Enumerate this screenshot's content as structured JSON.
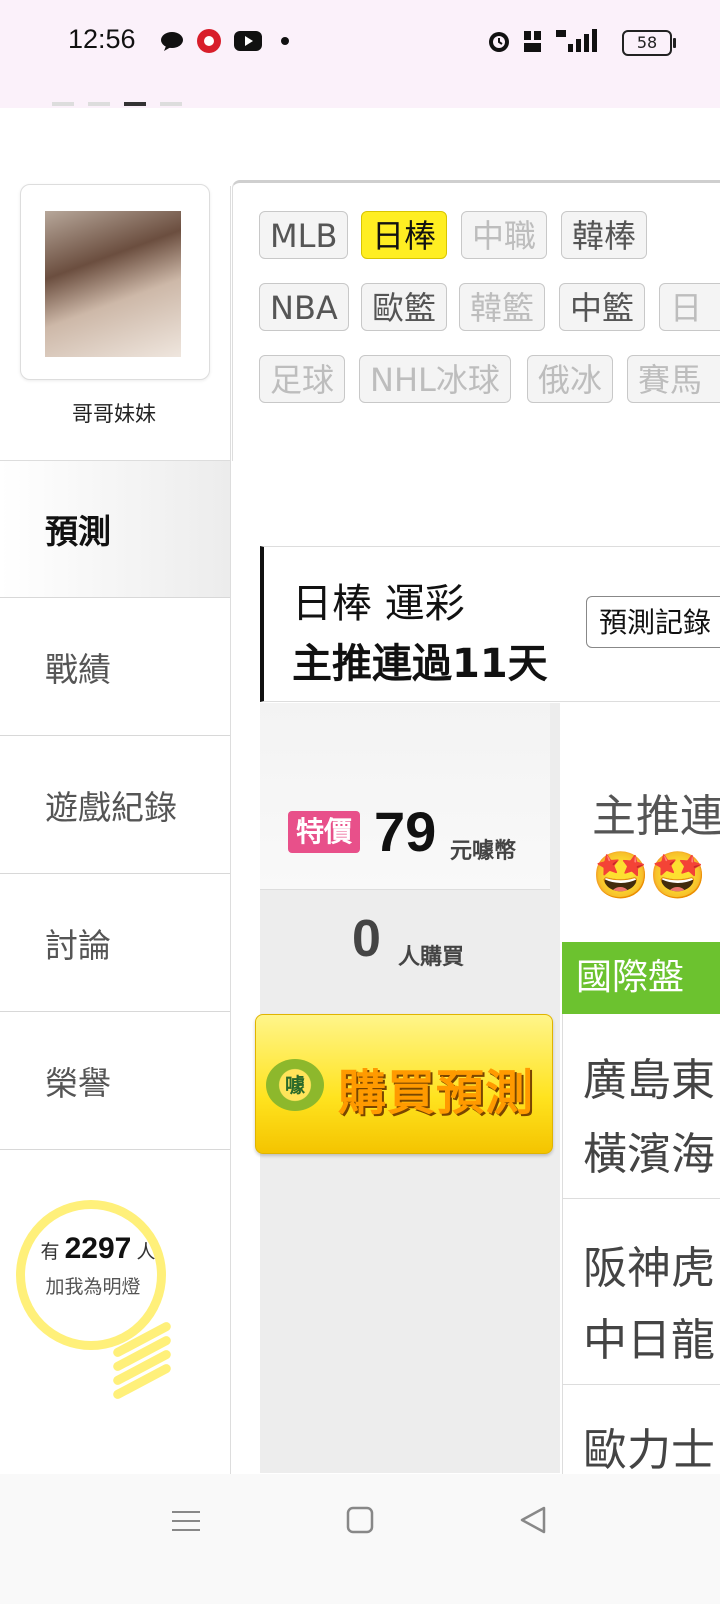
{
  "status_bar": {
    "time": "12:56",
    "battery": "58"
  },
  "profile": {
    "name": "哥哥妹妹"
  },
  "sidebar": {
    "items": [
      {
        "label": "預測"
      },
      {
        "label": "戰績"
      },
      {
        "label": "遊戲紀錄"
      },
      {
        "label": "討論"
      },
      {
        "label": "榮譽"
      }
    ]
  },
  "fans": {
    "prefix": "有",
    "count": "2297",
    "suffix": "人",
    "caption": "加我為明燈"
  },
  "sport_tags": {
    "row1": [
      {
        "label": "MLB",
        "state": "normal"
      },
      {
        "label": "日棒",
        "state": "selected"
      },
      {
        "label": "中職",
        "state": "disabled"
      },
      {
        "label": "韓棒",
        "state": "normal"
      }
    ],
    "row2": [
      {
        "label": "NBA",
        "state": "normal"
      },
      {
        "label": "歐籃",
        "state": "normal"
      },
      {
        "label": "韓籃",
        "state": "disabled"
      },
      {
        "label": "中籃",
        "state": "normal"
      },
      {
        "label": "日",
        "state": "disabled"
      }
    ],
    "row3": [
      {
        "label": "足球",
        "state": "disabled"
      },
      {
        "label": "NHL冰球",
        "state": "disabled"
      },
      {
        "label": "俄冰",
        "state": "disabled"
      },
      {
        "label": "賽馬",
        "state": "disabled"
      }
    ]
  },
  "prediction": {
    "title": "日棒 運彩",
    "streak": "主推連過11天",
    "record_button": "預測記錄",
    "special_badge": "特價",
    "price": "79",
    "price_unit": "元噱幣",
    "buyers": "0",
    "buyers_label": "人購買",
    "buy_button": "購買預測",
    "buy_coin": "噱",
    "description": "主推連",
    "emoji": "🤩🤩",
    "market_tab": "國際盤",
    "games": [
      {
        "home": "廣島東",
        "away": "橫濱海"
      },
      {
        "home": "阪神虎",
        "away": "中日龍"
      },
      {
        "home": "歐力士",
        "away": ""
      }
    ]
  },
  "colors": {
    "selected_tag": "#ffee22",
    "special_badge": "#e8508a",
    "market_tab": "#6cc22f",
    "buy_button": "#ffe31f",
    "bulb": "#fff07a"
  }
}
